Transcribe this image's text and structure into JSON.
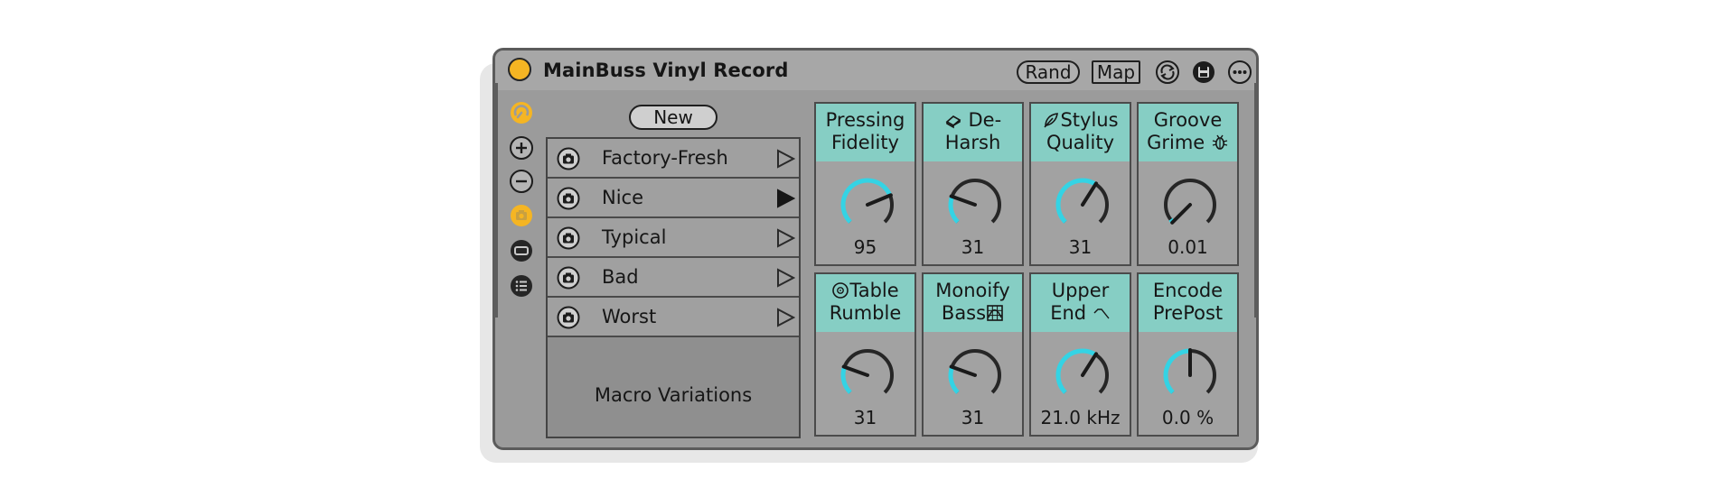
{
  "device": {
    "title": "MainBuss Vinyl Record",
    "rand_label": "Rand",
    "map_label": "Map",
    "accent": "#f5b523",
    "knob_color": "#34d3e4",
    "header_color": "#86cec4"
  },
  "variations": {
    "new_label": "New",
    "caption": "Macro Variations",
    "presets": [
      {
        "label": "Factory-Fresh",
        "active": false
      },
      {
        "label": "Nice",
        "active": true
      },
      {
        "label": "Typical",
        "active": false
      },
      {
        "label": "Bad",
        "active": false
      },
      {
        "label": "Worst",
        "active": false
      }
    ]
  },
  "macros": [
    {
      "line1": "Pressing",
      "line2": "Fidelity",
      "icon": "",
      "value": "95",
      "level": 0.75
    },
    {
      "line1": "De-",
      "line2": "Harsh",
      "icon": "eraser-icon",
      "value": "31",
      "level": 0.24
    },
    {
      "line1": "Stylus",
      "line2": "Quality",
      "icon": "feather-icon",
      "value": "31",
      "level": 0.62
    },
    {
      "line1": "Groove",
      "line2": "Grime",
      "icon": "bug-icon",
      "value": "0.01",
      "level": 0.0
    },
    {
      "line1": "Table",
      "line2": "Rumble",
      "icon": "record-icon",
      "value": "31",
      "level": 0.24
    },
    {
      "line1": "Monoify",
      "line2": "Bass",
      "icon": "grid-icon",
      "value": "31",
      "level": 0.24
    },
    {
      "line1": "Upper",
      "line2": "End",
      "icon": "filter-curve-icon",
      "value": "21.0 kHz",
      "level": 0.62
    },
    {
      "line1": "Encode",
      "line2": "PrePost",
      "icon": "",
      "value": "0.0 %",
      "level": 0.5
    }
  ]
}
